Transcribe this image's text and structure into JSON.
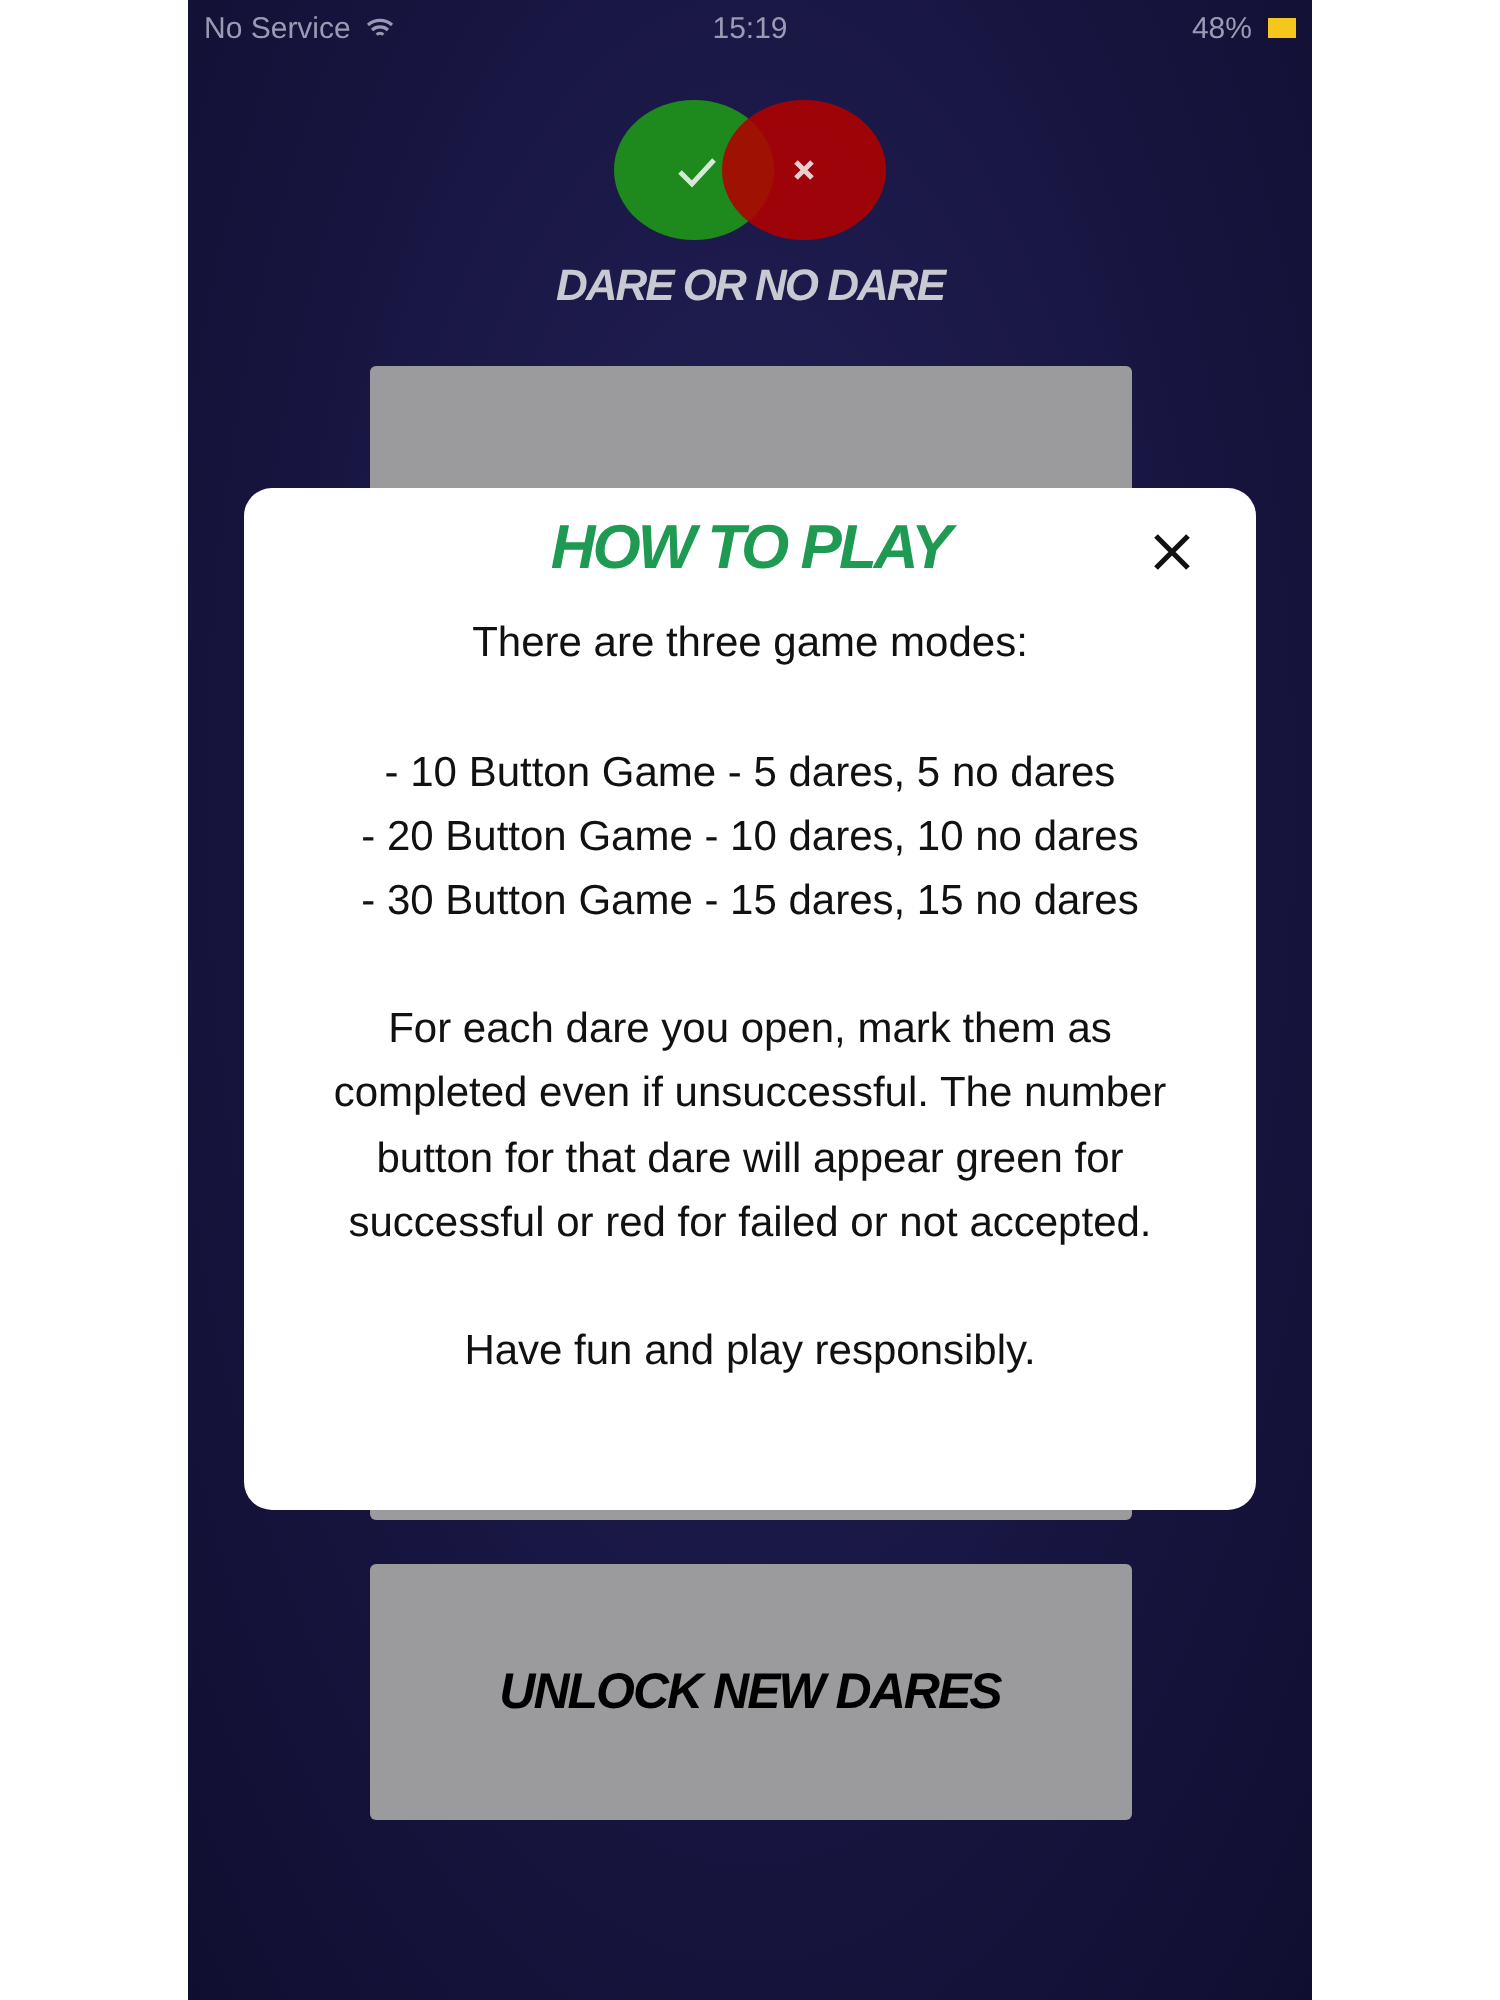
{
  "status_bar": {
    "carrier": "No Service",
    "time": "15:19",
    "battery": "48%"
  },
  "logo": {
    "title": "DARE OR NO DARE"
  },
  "unlock_button": {
    "label": "UNLOCK NEW DARES"
  },
  "dialog": {
    "title": "HOW TO PLAY",
    "intro": "There are three game modes:",
    "modes": [
      "- 10 Button Game - 5 dares, 5 no dares",
      "- 20 Button Game - 10 dares, 10 no dares",
      "- 30 Button Game - 15 dares, 15 no dares"
    ],
    "paragraphs": [
      "For each dare you open, mark them as completed even if unsuccessful. The number button for that dare will appear green for successful or red for failed or not accepted.",
      "Have fun and play responsibly."
    ]
  }
}
